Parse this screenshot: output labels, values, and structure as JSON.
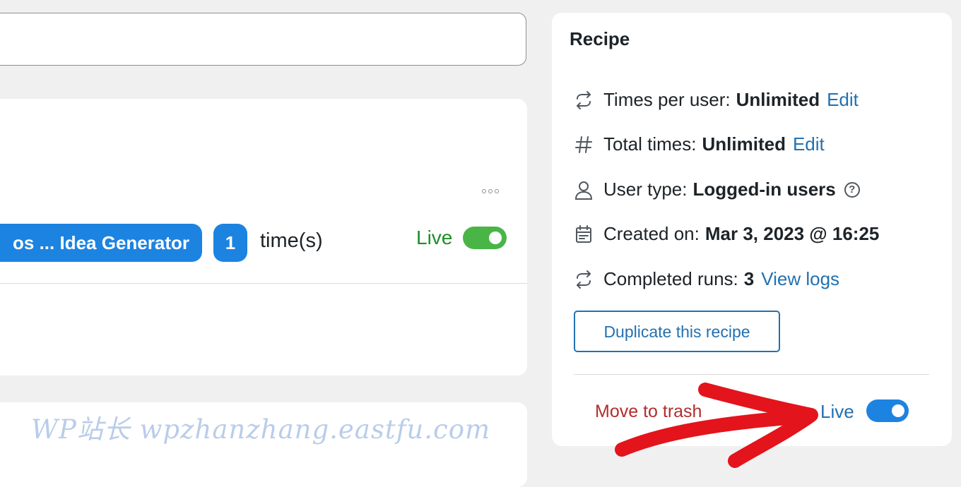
{
  "trigger": {
    "more_icon": "ellipsis-icon",
    "token_label": "os ... Idea Generator",
    "count": "1",
    "times_label": "time(s)",
    "live_label": "Live",
    "live_toggle_on": true
  },
  "recipe": {
    "title": "Recipe",
    "rows": [
      {
        "icon": "repeat-icon",
        "label": "Times per user:",
        "value": "Unlimited",
        "link": "Edit"
      },
      {
        "icon": "hash-icon",
        "label": "Total times:",
        "value": "Unlimited",
        "link": "Edit"
      },
      {
        "icon": "user-icon",
        "label": "User type:",
        "value": "Logged-in users",
        "help": "?"
      },
      {
        "icon": "calendar-icon",
        "label": "Created on:",
        "value": "Mar 3, 2023 @ 16:25"
      },
      {
        "icon": "repeat-icon",
        "label": "Completed runs:",
        "value": "3",
        "link": "View logs"
      }
    ],
    "duplicate_label": "Duplicate this recipe",
    "trash_label": "Move to trash",
    "live_label": "Live",
    "live_toggle_on": true
  },
  "watermark": "WP站长  wpzhanzhang.eastfu.com",
  "colors": {
    "accent_blue": "#1d83e0",
    "link_blue": "#2271b1",
    "live_green": "#1e8f29",
    "toggle_green": "#4ab547",
    "trash_red": "#b32d2e",
    "annotation_red": "#e3141b"
  }
}
